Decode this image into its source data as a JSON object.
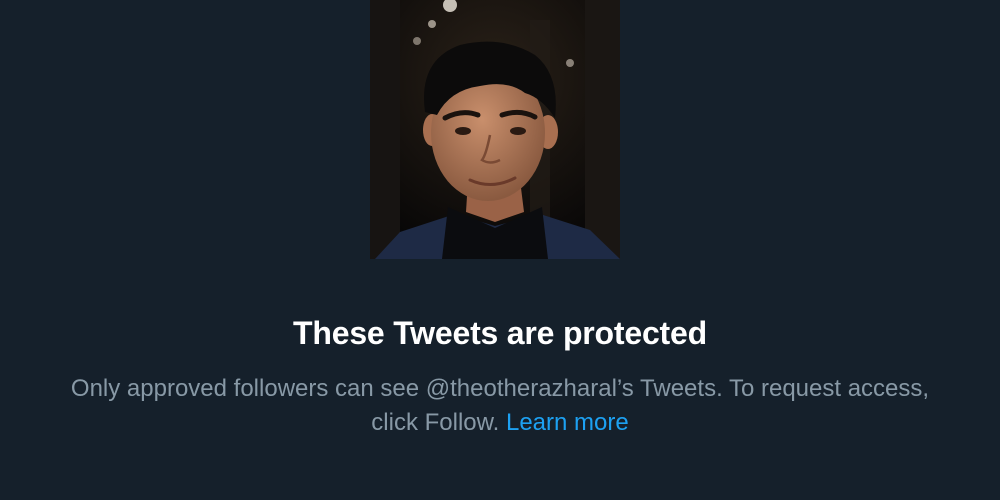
{
  "profile": {
    "photo": "profile-photo"
  },
  "protected": {
    "title": "These Tweets are protected",
    "message_line1": "Only approved followers can see @theotherazharal’s Tweets. To request access,",
    "message_line2_prefix": "click Follow.",
    "learn_more": "Learn more"
  },
  "colors": {
    "background": "#15202b",
    "title": "#ffffff",
    "message": "#8899a6",
    "link": "#1da1f2"
  }
}
